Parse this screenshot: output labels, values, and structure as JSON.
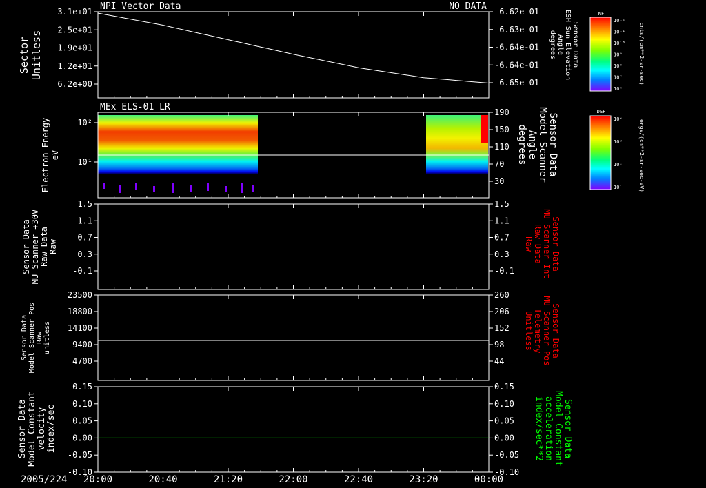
{
  "date_label": "2005/224",
  "x_ticks": [
    "20:00",
    "20:40",
    "21:20",
    "22:00",
    "22:40",
    "23:20",
    "00:00"
  ],
  "chart_data": [
    {
      "type": "line",
      "panel_title": "NPI Vector Data",
      "status": "NO DATA",
      "left_axis_label": [
        "Sector",
        "Unitless"
      ],
      "left_ticks": [
        "3.1e+01",
        "2.5e+01",
        "1.9e+01",
        "1.2e+01",
        "6.2e+00"
      ],
      "right_axis_label": [
        "Sensor Data",
        "ESH Sun Elevation",
        "Angle",
        "degrees"
      ],
      "right_ticks": [
        "-6.62e-01",
        "-6.63e-01",
        "-6.64e-01",
        "-6.64e-01",
        "-6.65e-01"
      ],
      "x": [
        "20:00",
        "20:40",
        "21:20",
        "22:00",
        "22:40",
        "23:20",
        "00:00"
      ],
      "series": [
        {
          "values": [
            31.5,
            27.0,
            21.6,
            16.2,
            11.2,
            7.5,
            5.5
          ],
          "color": "#ffffff"
        }
      ],
      "colorbar": {
        "label": "NF",
        "unit": "cnts/(cm**2-sr-sec)",
        "ticks": [
          "10¹²",
          "10¹¹",
          "10¹⁰",
          "10⁹",
          "10⁸",
          "10⁷",
          "10⁶"
        ]
      }
    },
    {
      "type": "heatmap",
      "panel_title": "MEx ELS-01 LR",
      "left_axis_label": [
        "Electron Energy",
        "eV"
      ],
      "left_ticks": [
        "10²",
        "10¹"
      ],
      "right_axis_label": [
        "Sensor Data",
        "Model Scanner",
        "Angle",
        "degrees"
      ],
      "right_ticks": [
        "190",
        "150",
        "110",
        "70",
        "30"
      ],
      "data_intervals": [
        [
          "20:00",
          "21:34"
        ],
        [
          "23:16",
          "23:59"
        ]
      ],
      "scanner_angle_value": 90,
      "colorbar": {
        "label": "DEF",
        "unit": "ergs/(cm**2-sr-sec-eV)",
        "ticks": [
          "10⁴",
          "10³",
          "10²",
          "10¹"
        ]
      }
    },
    {
      "type": "line",
      "left_axis_label": [
        "Sensor Data",
        "MU Scanner +30V",
        "Raw Data",
        "Raw"
      ],
      "left_ticks": [
        "1.5",
        "1.1",
        "0.7",
        "0.3",
        "-0.1"
      ],
      "right_axis_label": [
        "Sensor Data",
        "MU Scanner Int",
        "Raw Data",
        "Raw"
      ],
      "right_ticks": [
        "1.5",
        "1.1",
        "0.7",
        "0.3",
        "-0.1"
      ],
      "right_label_color": "#ff0000",
      "series": []
    },
    {
      "type": "line",
      "left_axis_label": [
        "Sensor Data",
        "Model Scanner Pos",
        "Raw",
        "unitless"
      ],
      "left_ticks": [
        "23500",
        "18800",
        "14100",
        "9400",
        "4700"
      ],
      "right_axis_label": [
        "Sensor Data",
        "MU Scanner Pos",
        "Telemetry",
        "Unitless"
      ],
      "right_ticks": [
        "260",
        "206",
        "152",
        "98",
        "44"
      ],
      "right_label_color": "#ff0000",
      "series": [
        {
          "values": [
            11700,
            11700
          ],
          "color": "#ffffff"
        }
      ]
    },
    {
      "type": "line",
      "left_axis_label": [
        "Sensor Data",
        "Model Constant",
        "velocity",
        "index/sec"
      ],
      "left_ticks": [
        "0.15",
        "0.10",
        "0.05",
        "0.00",
        "-0.05",
        "-0.10"
      ],
      "right_axis_label": [
        "Sensor Data",
        "Model Constant",
        "acceleration",
        "index/sec**2"
      ],
      "right_ticks": [
        "0.15",
        "0.10",
        "0.05",
        "0.00",
        "-0.05",
        "-0.10"
      ],
      "right_label_color": "#00ff00",
      "series": [
        {
          "values": [
            0.0,
            0.0
          ],
          "color": "#00ff00"
        }
      ]
    }
  ]
}
